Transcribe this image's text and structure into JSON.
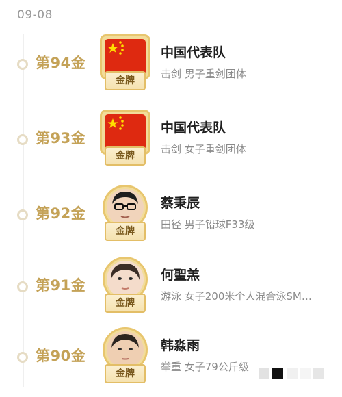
{
  "date": "09-08",
  "ribbon_label": "金牌",
  "colors": {
    "gold_text": "#c4a257",
    "flag_red": "#de2910",
    "flag_star": "#ffde00"
  },
  "medals": [
    {
      "rank": "第94金",
      "name": "中国代表队",
      "event": "击剑  男子重剑团体",
      "badge": "china-flag"
    },
    {
      "rank": "第93金",
      "name": "中国代表队",
      "event": "击剑  女子重剑团体",
      "badge": "china-flag"
    },
    {
      "rank": "第92金",
      "name": "蔡秉辰",
      "event": "田径  男子铅球F33级",
      "badge": "athlete-photo"
    },
    {
      "rank": "第91金",
      "name": "何聖羔",
      "event": "游泳  女子200米个人混合泳SM…",
      "badge": "athlete-photo"
    },
    {
      "rank": "第90金",
      "name": "韩淼雨",
      "event": "举重  女子79公斤级",
      "badge": "athlete-photo"
    }
  ]
}
